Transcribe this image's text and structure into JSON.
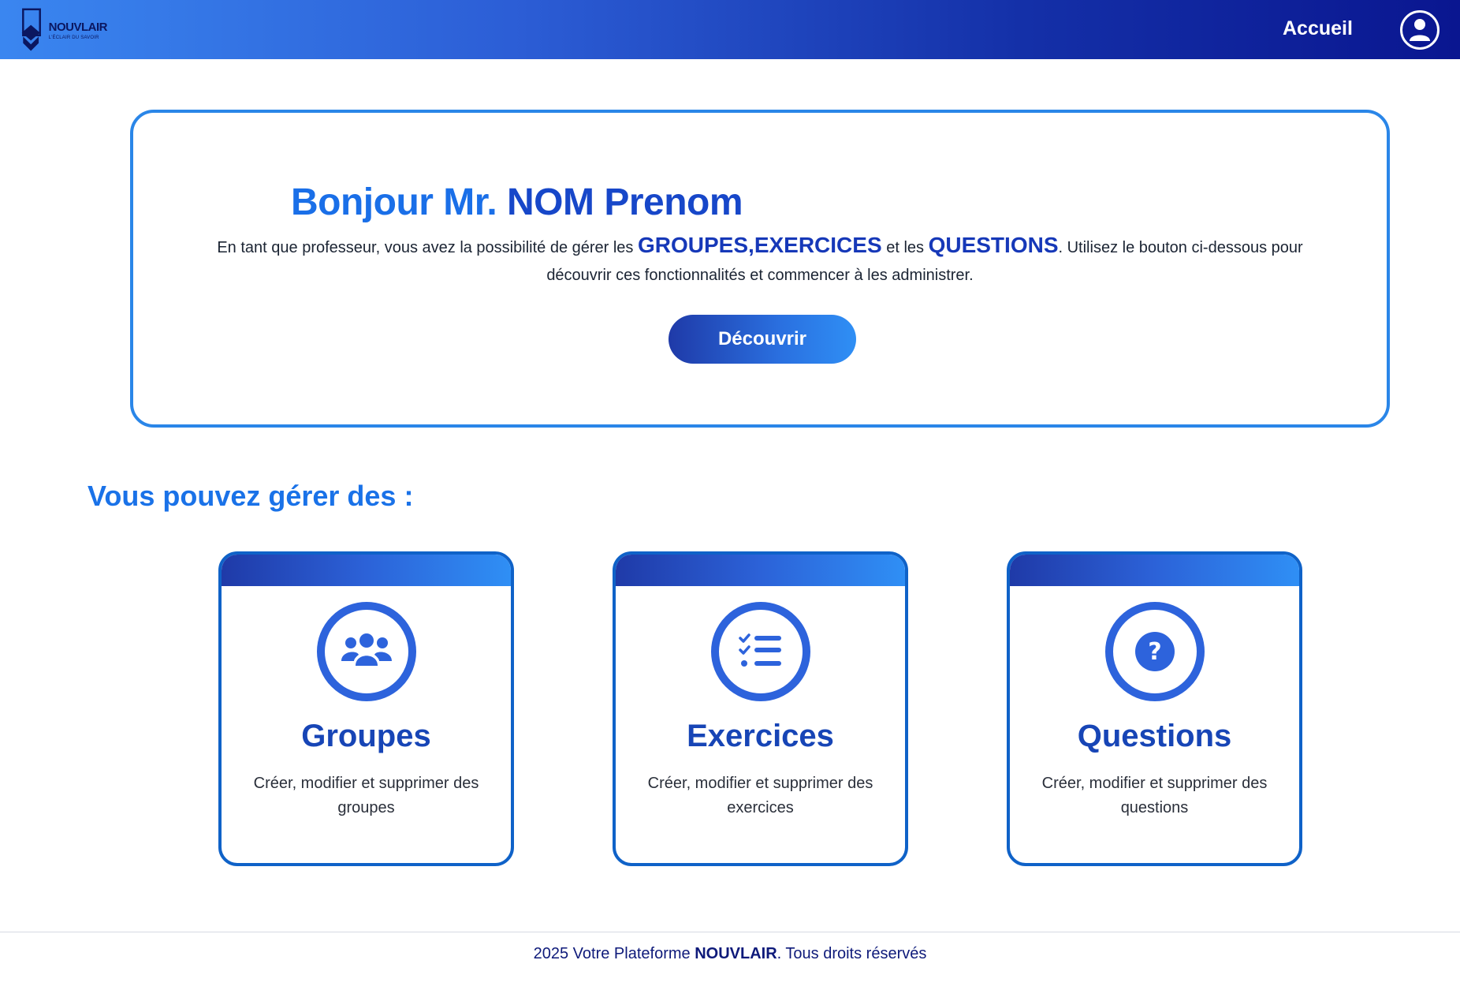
{
  "header": {
    "logo_name": "NOUVLAIR",
    "logo_tagline": "L'ÉCLAIR DU SAVOIR",
    "nav_home": "Accueil"
  },
  "welcome": {
    "greeting": "Bonjour Mr.",
    "name": "NOM Prenom",
    "text_part1": "En tant que professeur, vous avez la possibilité de gérer les",
    "hl_groups": "GROUPES",
    "sep": ",",
    "hl_exercises": "EXERCICES",
    "text_and": "et les",
    "hl_questions": "QUESTIONS",
    "text_part2": ". Utilisez le bouton ci-dessous pour découvrir ces fonctionnalités et commencer à les administrer.",
    "button": "Découvrir"
  },
  "manage_heading": "Vous pouvez gérer des :",
  "cards": [
    {
      "icon": "users-icon",
      "title": "Groupes",
      "description": "Créer, modifier et supprimer des groupes"
    },
    {
      "icon": "list-check-icon",
      "title": "Exercices",
      "description": "Créer, modifier et supprimer des exercices"
    },
    {
      "icon": "question-icon",
      "title": "Questions",
      "description": "Créer, modifier et supprimer des questions"
    }
  ],
  "footer": {
    "prefix": "2025 Votre Plateforme",
    "brand": "NOUVLAIR",
    "suffix": ". Tous droits réservés"
  },
  "colors": {
    "accent": "#1a72e8",
    "card_border": "#0f62c8",
    "icon_blue": "#2d63dc",
    "header_dark": "#0a1690"
  }
}
